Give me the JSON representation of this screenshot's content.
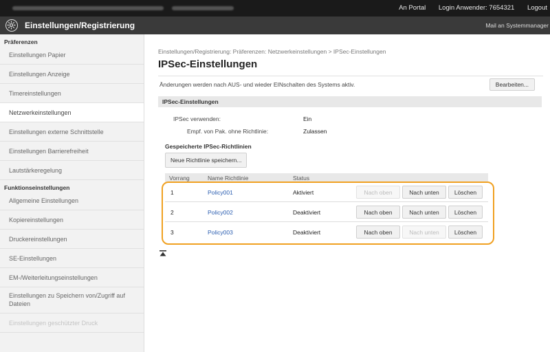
{
  "header": {
    "portal_link": "An Portal",
    "login_user": "Login Anwender: 7654321",
    "logout": "Logout"
  },
  "titlebar": {
    "title": "Einstellungen/Registrierung",
    "mail": "Mail an Systemmanager"
  },
  "sidebar": {
    "section1": "Präferenzen",
    "items1": [
      "Einstellungen Papier",
      "Einstellungen Anzeige",
      "Timereinstellungen",
      "Netzwerkeinstellungen",
      "Einstellungen externe Schnittstelle",
      "Einstellungen Barrierefreiheit",
      "Lautstärkeregelung"
    ],
    "section2": "Funktionseinstellungen",
    "items2": [
      "Allgemeine Einstellungen",
      "Kopiereinstellungen",
      "Druckereinstellungen",
      "SE-Einstellungen",
      "EM-/Weiterleitungseinstellungen",
      "Einstellungen zu Speichern von/Zugriff auf Dateien",
      "Einstellungen geschützter Druck"
    ]
  },
  "main": {
    "breadcrumb": "Einstellungen/Registrierung: Präferenzen: Netzwerkeinstellungen > IPSec-Einstellungen",
    "page_title": "IPSec-Einstellungen",
    "notice": "Änderungen werden nach AUS- und wieder EINschalten des Systems aktiv.",
    "edit_button": "Bearbeiten...",
    "section_title": "IPSec-Einstellungen",
    "use_ipsec_label": "IPSec verwenden:",
    "use_ipsec_value": "Ein",
    "receive_label": "Empf. von Pak. ohne Richtlinie:",
    "receive_value": "Zulassen",
    "saved_policies_title": "Gespeicherte IPSec-Richtlinien",
    "save_new_button": "Neue Richtlinie speichern...",
    "table": {
      "headers": [
        "Vorrang",
        "Name Richtlinie",
        "Status"
      ],
      "rows": [
        {
          "priority": "1",
          "name": "Policy001",
          "status": "Aktiviert",
          "up": "Nach oben",
          "down": "Nach unten",
          "delete": "Löschen"
        },
        {
          "priority": "2",
          "name": "Policy002",
          "status": "Deaktiviert",
          "up": "Nach oben",
          "down": "Nach unten",
          "delete": "Löschen"
        },
        {
          "priority": "3",
          "name": "Policy003",
          "status": "Deaktiviert",
          "up": "Nach oben",
          "down": "Nach unten",
          "delete": "Löschen"
        }
      ]
    }
  },
  "colors": {
    "highlight": "#f0a020",
    "link": "#2a5db0",
    "topbar": "#1a1a1a",
    "titlebar": "#3a3a3a"
  }
}
